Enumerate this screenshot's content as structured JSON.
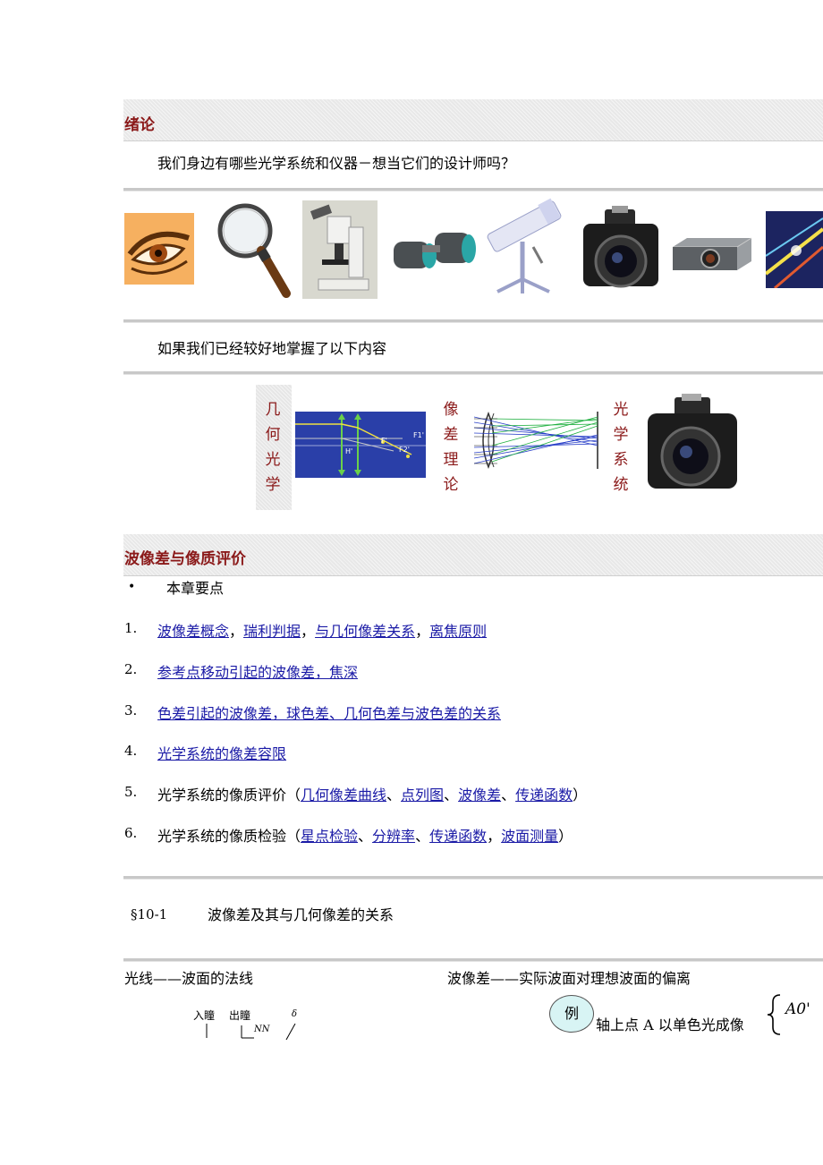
{
  "section1": {
    "title": "绪论",
    "question": "我们身边有哪些光学系统和仪器－想当它们的设计师吗？",
    "images": [
      "eye",
      "magnifying-glass",
      "microscope",
      "binoculars",
      "telescope",
      "camera",
      "projector",
      "laser"
    ]
  },
  "section2": {
    "intro": "如果我们已经较好地掌握了以下内容",
    "label_left": [
      "几",
      "何",
      "光",
      "学"
    ],
    "label_mid": [
      "像",
      "差",
      "理",
      "论"
    ],
    "label_right": [
      "光",
      "学",
      "系",
      "统"
    ],
    "diagram_labels": {
      "f1": "F1'",
      "f": "F'",
      "h": "H'",
      "f2": "F2'"
    }
  },
  "section3": {
    "title": "波像差与像质评价",
    "bullet_glyph": "•",
    "bullet_text": "本章要点",
    "items": [
      {
        "num": "1.",
        "parts": [
          {
            "t": "波像差概念",
            "link": true
          },
          {
            "t": "，",
            "link": false
          },
          {
            "t": "瑞利判据",
            "link": true
          },
          {
            "t": "，",
            "link": false
          },
          {
            "t": "与几何像差关系",
            "link": true
          },
          {
            "t": "，",
            "link": false
          },
          {
            "t": "离焦原则",
            "link": true
          }
        ]
      },
      {
        "num": "2.",
        "parts": [
          {
            "t": "参考点移动引起的波像差，焦深",
            "link": true
          }
        ]
      },
      {
        "num": "3.",
        "parts": [
          {
            "t": "色差引起的波像差，球色差、几何色差与波色差的关系",
            "link": true
          }
        ]
      },
      {
        "num": "4.",
        "parts": [
          {
            "t": "光学系统的像差容限",
            "link": true
          }
        ]
      },
      {
        "num": "5.",
        "parts": [
          {
            "t": "光学系统的像质评价（",
            "link": false
          },
          {
            "t": "几何像差曲线",
            "link": true
          },
          {
            "t": "、",
            "link": false
          },
          {
            "t": "点列图",
            "link": true
          },
          {
            "t": "、",
            "link": false
          },
          {
            "t": "波像差",
            "link": true
          },
          {
            "t": "、",
            "link": false
          },
          {
            "t": "传递函数",
            "link": true
          },
          {
            "t": "）",
            "link": false
          }
        ]
      },
      {
        "num": "6.",
        "parts": [
          {
            "t": "光学系统的像质检验（",
            "link": false
          },
          {
            "t": "星点检验",
            "link": true
          },
          {
            "t": "、",
            "link": false
          },
          {
            "t": "分辨率",
            "link": true
          },
          {
            "t": "、",
            "link": false
          },
          {
            "t": "传递函数",
            "link": true
          },
          {
            "t": "，",
            "link": false
          },
          {
            "t": "波面测量",
            "link": true
          },
          {
            "t": "）",
            "link": false
          }
        ]
      }
    ]
  },
  "section4": {
    "heading_num": "§10-1",
    "heading_text": "波像差及其与几何像差的关系",
    "left_label": "光线——波面的法线",
    "right_label": "波像差——实际波面对理想波面的偏离",
    "pupil_in": "入瞳",
    "pupil_out": "出瞳",
    "fig_marks": "NN",
    "delta": "δ",
    "example": "例",
    "example_text": "轴上点 A 以单色光成像",
    "brace_text": "A0'"
  }
}
